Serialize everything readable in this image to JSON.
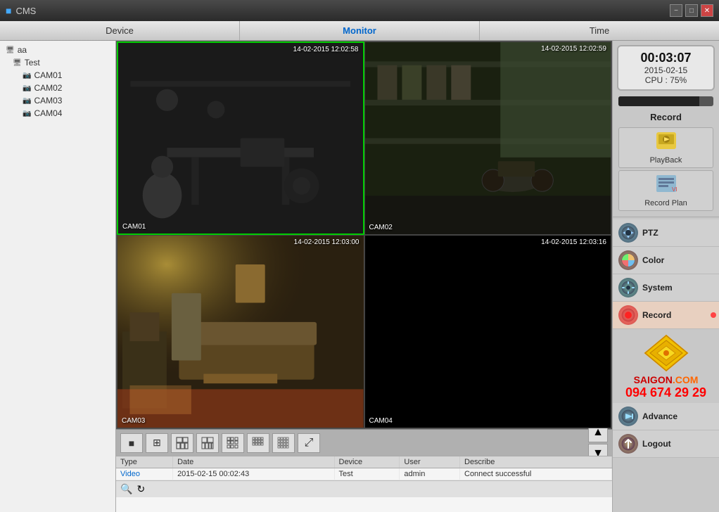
{
  "titlebar": {
    "icon": "●",
    "title": "CMS",
    "minimize": "−",
    "maximize": "□",
    "close": "✕"
  },
  "header": {
    "tabs": [
      {
        "label": "Device",
        "id": "device"
      },
      {
        "label": "Monitor",
        "id": "monitor"
      },
      {
        "label": "Time",
        "id": "time"
      }
    ]
  },
  "sidebar": {
    "group_label": "aa",
    "test_label": "Test",
    "cameras": [
      "CAM01",
      "CAM02",
      "CAM03",
      "CAM04"
    ]
  },
  "cameras": [
    {
      "id": "CAM01",
      "timestamp": "14-02-2015 12:02:58",
      "label": "CAM01",
      "active": true
    },
    {
      "id": "CAM02",
      "timestamp": "14-02-2015 12:02:59",
      "label": "CAM02",
      "active": false
    },
    {
      "id": "CAM03",
      "timestamp": "14-02-2015 12:03:00",
      "label": "CAM03",
      "active": false
    },
    {
      "id": "CAM04",
      "timestamp": "14-02-2015 12:03:16",
      "label": "CAM04",
      "active": false
    }
  ],
  "toolbar": {
    "buttons": [
      "■",
      "⊞",
      "⊟",
      "⊠",
      "⊞⊞",
      "⊠⊠",
      "▦",
      "⤢"
    ],
    "up_arrow": "▲",
    "down_arrow": "▼"
  },
  "status": {
    "time": "00:03:07",
    "date": "2015-02-15",
    "cpu_label": "CPU :",
    "cpu_value": "75%"
  },
  "right_panel": {
    "record_label": "Record",
    "playback_label": "PlayBack",
    "record_plan_label": "Record Plan"
  },
  "side_actions": [
    {
      "label": "PTZ",
      "icon": "◎",
      "active": false
    },
    {
      "label": "Color",
      "icon": "◑",
      "active": false
    },
    {
      "label": "System",
      "icon": "⚙",
      "active": false
    },
    {
      "label": "Record",
      "icon": "⏺",
      "active": true
    },
    {
      "label": "Advance",
      "icon": "◎",
      "active": false
    },
    {
      "label": "Logout",
      "icon": "⏏",
      "active": false
    }
  ],
  "log": {
    "headers": [
      "Type",
      "Date",
      "Device",
      "User",
      "Describe"
    ],
    "rows": [
      {
        "type": "Video",
        "date": "2015-02-15 00:02:43",
        "device": "Test",
        "user": "admin",
        "describe": "Connect successful"
      }
    ]
  },
  "saigon": {
    "phone": "094 674 29 29",
    "brand": "SAIGON.COM"
  }
}
